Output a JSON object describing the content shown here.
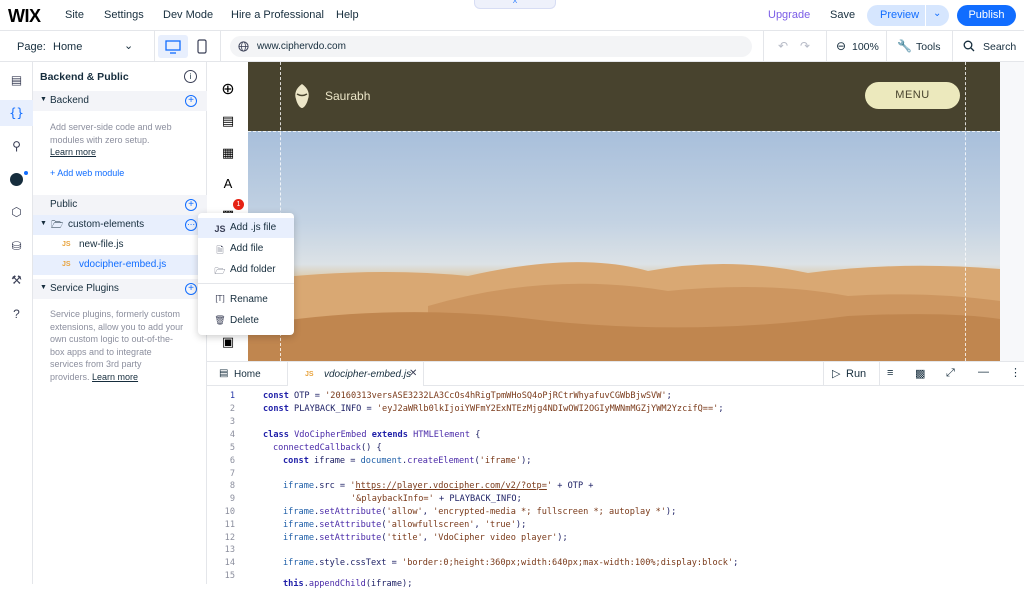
{
  "topbar": {
    "logo": "WIX",
    "menu": [
      "Site",
      "Settings",
      "Dev Mode",
      "Hire a Professional",
      "Help"
    ],
    "upgrade": "Upgrade",
    "save": "Save",
    "preview": "Preview",
    "publish": "Publish",
    "handle": "^"
  },
  "bar2": {
    "page_label": "Page:",
    "page_value": "Home",
    "url": "www.ciphervdo.com",
    "zoom": "100%",
    "tools": "Tools",
    "search": "Search"
  },
  "panel": {
    "title": "Backend & Public",
    "backend": {
      "label": "Backend",
      "desc": [
        "Add server-side code and web",
        "modules with zero setup."
      ],
      "learn_more": "Learn more",
      "add_module": "+ Add web module"
    },
    "public": {
      "label": "Public",
      "folder": "custom-elements",
      "files": [
        "new-file.js",
        "vdocipher-embed.js"
      ],
      "js_tag": "JS"
    },
    "service_plugins": {
      "label": "Service Plugins",
      "desc": [
        "Service plugins, formerly custom",
        "extensions, allow you to add your",
        "own custom logic to out-of-the-",
        "box apps and to integrate",
        "services from 3rd party",
        "providers."
      ],
      "learn_more": "Learn more"
    }
  },
  "context_menu": {
    "items": [
      "Add .js file",
      "Add file",
      "Add folder",
      "Rename",
      "Delete"
    ]
  },
  "site": {
    "name": "Saurabh",
    "menu": "MENU"
  },
  "badge": "1",
  "editor": {
    "tabs": [
      "Home",
      "vdocipher-embed.js"
    ],
    "run": "Run",
    "line_numbers": [
      "1",
      "2",
      "3",
      "4",
      "5",
      "6",
      "7",
      "8",
      "9",
      "10",
      "11",
      "12",
      "13",
      "14",
      "15"
    ]
  },
  "colors": {
    "accent": "#116dff",
    "upgrade": "#7a5ce6",
    "site_header": "#48432e",
    "menu_button": "#ece9bd"
  }
}
